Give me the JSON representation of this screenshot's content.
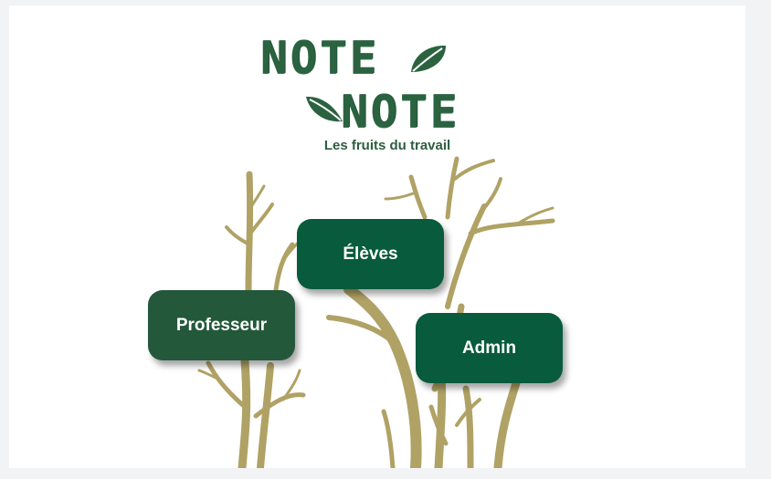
{
  "logo": {
    "line1": "NOTE",
    "line2": "NOTE",
    "tagline": "Les fruits du travail",
    "brand_color": "#2b6240",
    "leaf_icon": "leaf-icon"
  },
  "roles": {
    "eleves": "Élèves",
    "professeur": "Professeur",
    "admin": "Admin"
  },
  "colors": {
    "button_green": "#085b3c",
    "button_green_alt": "#24583a",
    "branch_color": "#b0a265"
  },
  "decoration": {
    "branches_icon": "tree-branches"
  }
}
